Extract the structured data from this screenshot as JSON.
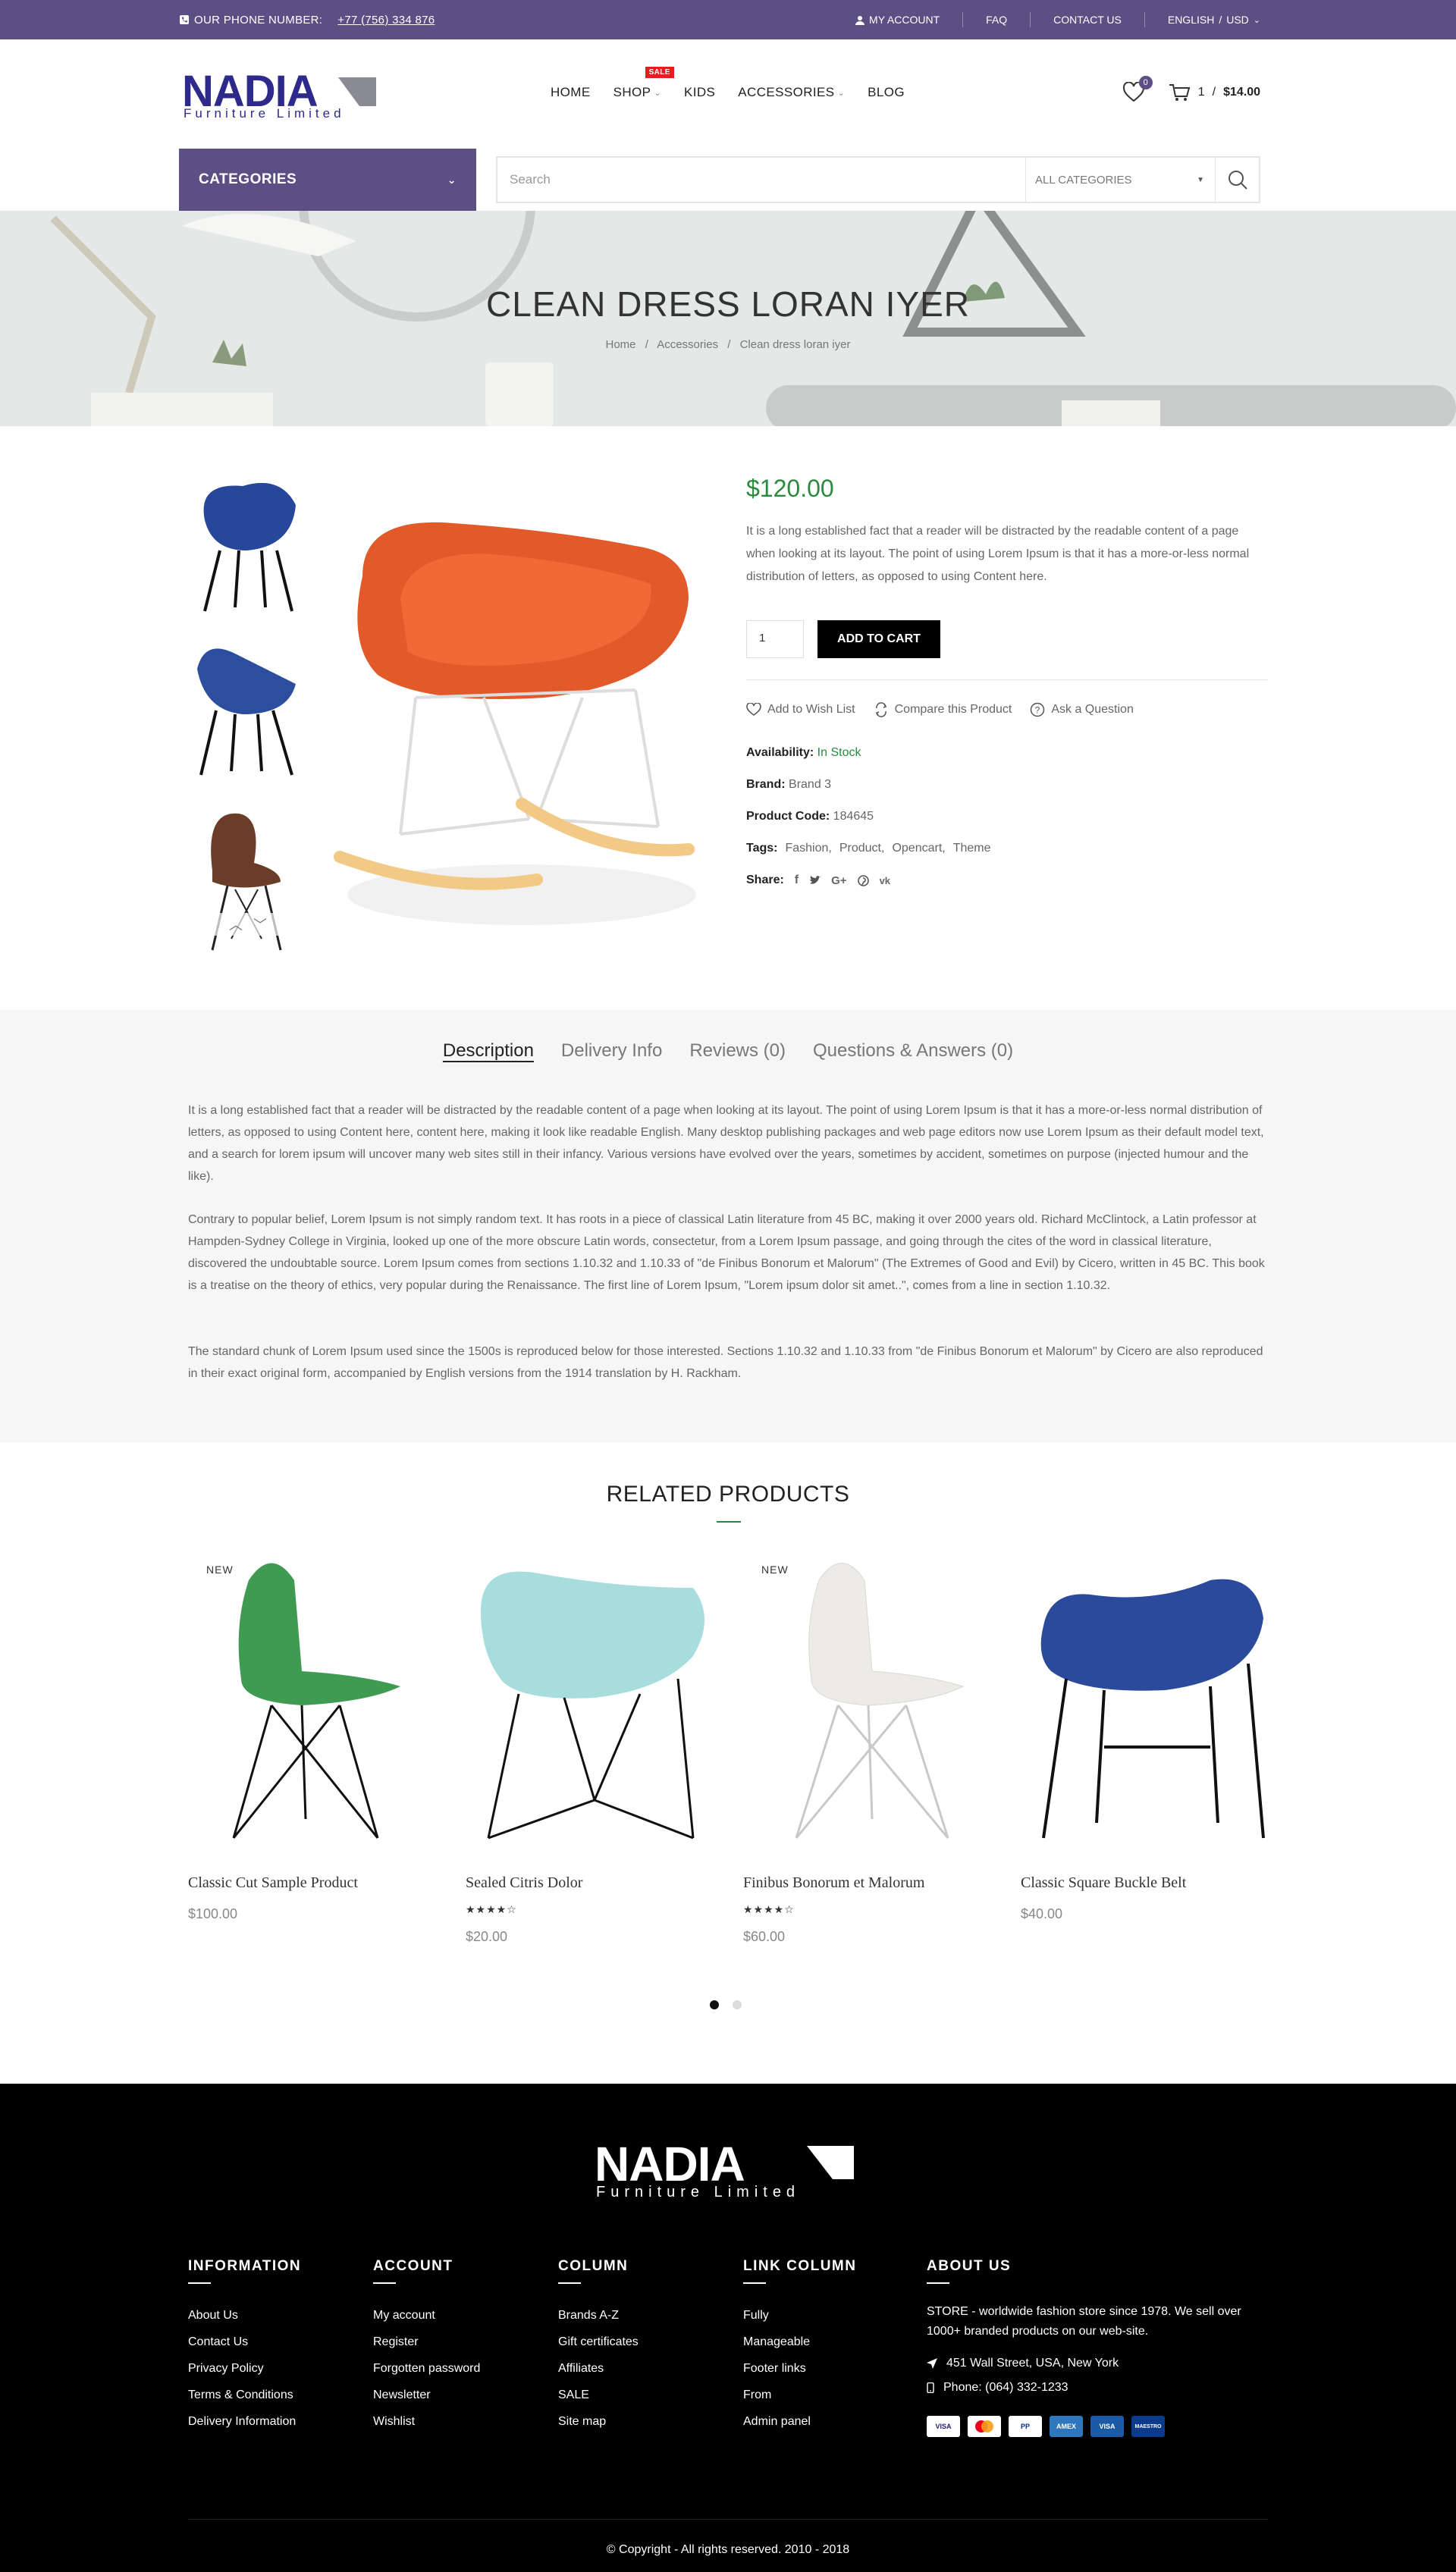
{
  "topbar": {
    "phone_label": "OUR PHONE NUMBER:",
    "phone_number": "+77 (756) 334 876",
    "links": [
      "MY ACCOUNT",
      "FAQ",
      "CONTACT US"
    ],
    "language": "ENGLISH",
    "currency": "USD"
  },
  "header": {
    "logo_word": "NADIA",
    "logo_tagline": "Furniture Limited",
    "nav": [
      "HOME",
      "SHOP",
      "KIDS",
      "ACCESSORIES",
      "BLOG"
    ],
    "sale_badge": "SALE",
    "wishlist_count": "0",
    "cart_count": "1",
    "cart_total": "$14.00"
  },
  "categories_button": "CATEGORIES",
  "search": {
    "placeholder": "Search",
    "category": "ALL CATEGORIES"
  },
  "banner": {
    "title": "CLEAN DRESS LORAN IYER",
    "breadcrumb": [
      "Home",
      "Accessories",
      "Clean dress loran iyer"
    ]
  },
  "product": {
    "price": "$120.00",
    "description": "It is a long established fact that a reader will be distracted by the readable content of a page when looking at its layout. The point of using Lorem Ipsum is that it has a more-or-less normal distribution of letters, as opposed to using Content here.",
    "quantity": "1",
    "add_to_cart": "ADD TO CART",
    "actions": [
      "Add to Wish List",
      "Compare this Product",
      "Ask a Question"
    ],
    "availability_label": "Availability:",
    "availability_value": "In Stock",
    "brand_label": "Brand:",
    "brand_value": "Brand 3",
    "code_label": "Product Code:",
    "code_value": "184645",
    "tags_label": "Tags:",
    "tags": [
      "Fashion,",
      "Product,",
      "Opencart,",
      "Theme"
    ],
    "share_label": "Share:"
  },
  "tabs": [
    "Description",
    "Delivery Info",
    "Reviews (0)",
    "Questions & Answers (0)"
  ],
  "tab_paragraphs": [
    "It is a long established fact that a reader will be distracted by the readable content of a page when looking at its layout. The point of using Lorem Ipsum is that it has a more-or-less normal distribution of letters, as opposed to using Content here, content here, making it look like readable English. Many desktop publishing packages and web page editors now use Lorem Ipsum as their default model text, and a search for lorem ipsum will uncover many web sites still in their infancy. Various versions have evolved over the years, sometimes by accident, sometimes on purpose (injected humour and the like).",
    "Contrary to popular belief, Lorem Ipsum is not simply random text. It has roots in a piece of classical Latin literature from 45 BC, making it over 2000 years old. Richard McClintock, a Latin professor at Hampden-Sydney College in Virginia, looked up one of the more obscure Latin words, consectetur, from a Lorem Ipsum passage, and going through the cites of the word in classical literature, discovered the undoubtable source. Lorem Ipsum comes from sections 1.10.32 and 1.10.33 of \"de Finibus Bonorum et Malorum\" (The Extremes of Good and Evil) by Cicero, written in 45 BC. This book is a treatise on the theory of ethics, very popular during the Renaissance. The first line of Lorem Ipsum, \"Lorem ipsum dolor sit amet..\", comes from a line in section 1.10.32.",
    "The standard chunk of Lorem Ipsum used since the 1500s is reproduced below for those interested. Sections 1.10.32 and 1.10.33 from \"de Finibus Bonorum et Malorum\" by Cicero are also reproduced in their exact original form, accompanied by English versions from the 1914 translation by H. Rackham."
  ],
  "related": {
    "title": "RELATED PRODUCTS",
    "items": [
      {
        "name": "Classic Cut Sample Product",
        "price": "$100.00",
        "badge": "NEW",
        "rating": 0,
        "color": "#3f9a52"
      },
      {
        "name": "Sealed Citris Dolor",
        "price": "$20.00",
        "badge": "",
        "rating": 4,
        "color": "#a7dedd"
      },
      {
        "name": "Finibus Bonorum et Malorum",
        "price": "$60.00",
        "badge": "NEW",
        "rating": 4,
        "color": "#ecebe7"
      },
      {
        "name": "Classic Square Buckle Belt",
        "price": "$40.00",
        "badge": "",
        "rating": 0,
        "color": "#2c4a9c"
      }
    ]
  },
  "footer": {
    "logo_word": "NADIA",
    "logo_tagline": "Furniture Limited",
    "information": {
      "title": "INFORMATION",
      "links": [
        "About Us",
        "Contact Us",
        "Privacy Policy",
        "Terms & Conditions",
        "Delivery Information"
      ]
    },
    "account": {
      "title": "ACCOUNT",
      "links": [
        "My account",
        "Register",
        "Forgotten password",
        "Newsletter",
        "Wishlist"
      ]
    },
    "column": {
      "title": "COLUMN",
      "links": [
        "Brands A-Z",
        "Gift certificates",
        "Affiliates",
        "SALE",
        "Site map"
      ]
    },
    "link_column": {
      "title": "LINK COLUMN",
      "links": [
        "Fully",
        "Manageable",
        "Footer links",
        "From",
        "Admin panel"
      ]
    },
    "about": {
      "title": "ABOUT US",
      "text": "STORE - worldwide fashion store since 1978. We sell over 1000+ branded products on our web-site.",
      "address": "451 Wall Street, USA, New York",
      "phone": "Phone: (064) 332-1233"
    },
    "payments": [
      "VISA",
      "MC",
      "PP",
      "AMEX",
      "VISA",
      "MAESTRO"
    ],
    "copyright": "© Copyright - All rights reserved. 2010 - 2018"
  },
  "colors": {
    "brand_purple": "#5c4f84",
    "price_green": "#2a8a3e",
    "logo_blue": "#2d2a8c"
  }
}
